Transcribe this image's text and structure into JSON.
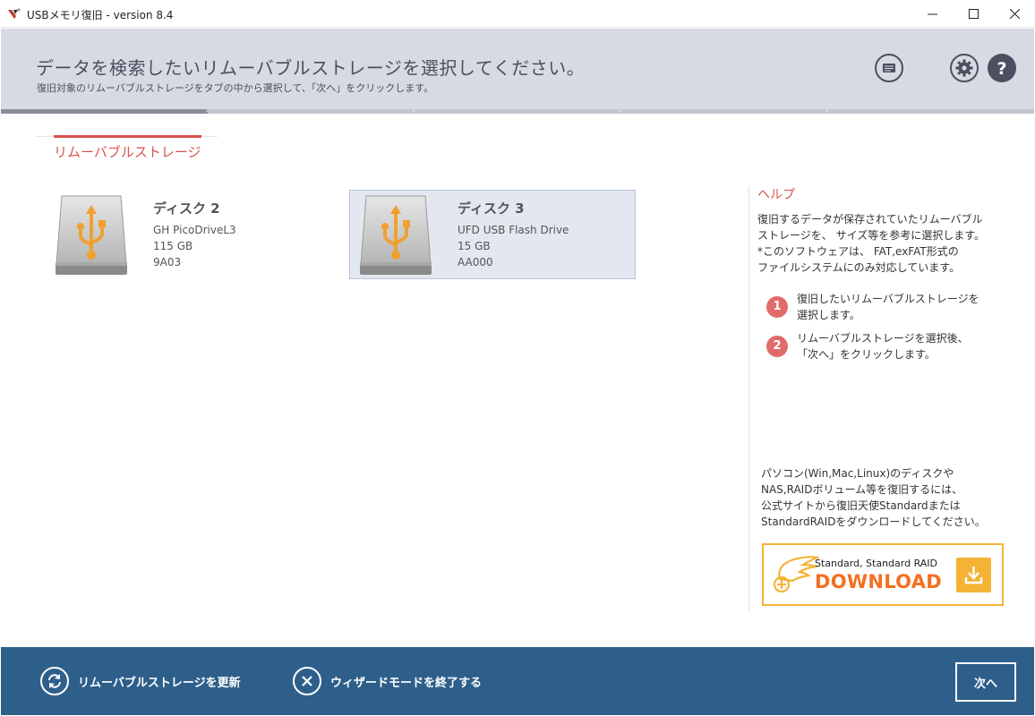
{
  "window": {
    "title": "USBメモリ復旧 - version 8.4",
    "minimize_glyph": "—",
    "maximize_glyph": "☐",
    "close_glyph": "✕"
  },
  "header": {
    "title": "データを検索したいリムーバブルストレージを選択してください。",
    "subtitle": "復旧対象のリムーバブルストレージをタブの中から選択して、「次へ」をクリックします。",
    "icons": [
      "log-icon",
      "gear-icon",
      "help-icon"
    ],
    "progress_step": 1,
    "progress_total": 5
  },
  "tabs": [
    {
      "label": "リムーバブルストレージ",
      "active": true
    }
  ],
  "disks": [
    {
      "name": "ディスク 2",
      "model": "GH PicoDriveL3",
      "size": "115 GB",
      "id": "9A03",
      "selected": false,
      "icon": "usb-drive-icon"
    },
    {
      "name": "ディスク 3",
      "model": "UFD USB Flash Drive",
      "size": "15 GB",
      "id": "AA000",
      "selected": true,
      "icon": "usb-drive-icon"
    }
  ],
  "help": {
    "title": "ヘルプ",
    "body": [
      "復旧するデータが保存されていたリムーバブル",
      "ストレージを、 サイズ等を参考に選択します。",
      "*このソフトウェアは、 FAT,exFAT形式の",
      "ファイルシステムにのみ対応しています。"
    ],
    "steps": [
      {
        "num": "1",
        "lines": [
          "復旧したいリムーバブルストレージを",
          "選択します。"
        ]
      },
      {
        "num": "2",
        "lines": [
          "リムーバブルストレージを選択後、",
          "「次へ」をクリックします。"
        ]
      }
    ],
    "promo": [
      "パソコン(Win,Mac,Linux)のディスクや",
      "NAS,RAIDボリューム等を復旧するには、",
      "公式サイトから復旧天使Standardまたは",
      "StandardRAIDをダウンロードしてください。"
    ],
    "download": {
      "sub": "Standard, Standard RAID",
      "main": "DOWNLOAD"
    }
  },
  "footer": {
    "refresh_label": "リムーバブルストレージを更新",
    "exit_label": "ウィザードモードを終了する",
    "next_label": "次へ"
  },
  "colors": {
    "accent_red": "#d9534f",
    "footer_blue": "#2e5f8a",
    "header_bg": "#d8dae3",
    "download_orange": "#f37021",
    "download_yellow": "#f5b336",
    "usb_orange": "#f0a030"
  }
}
